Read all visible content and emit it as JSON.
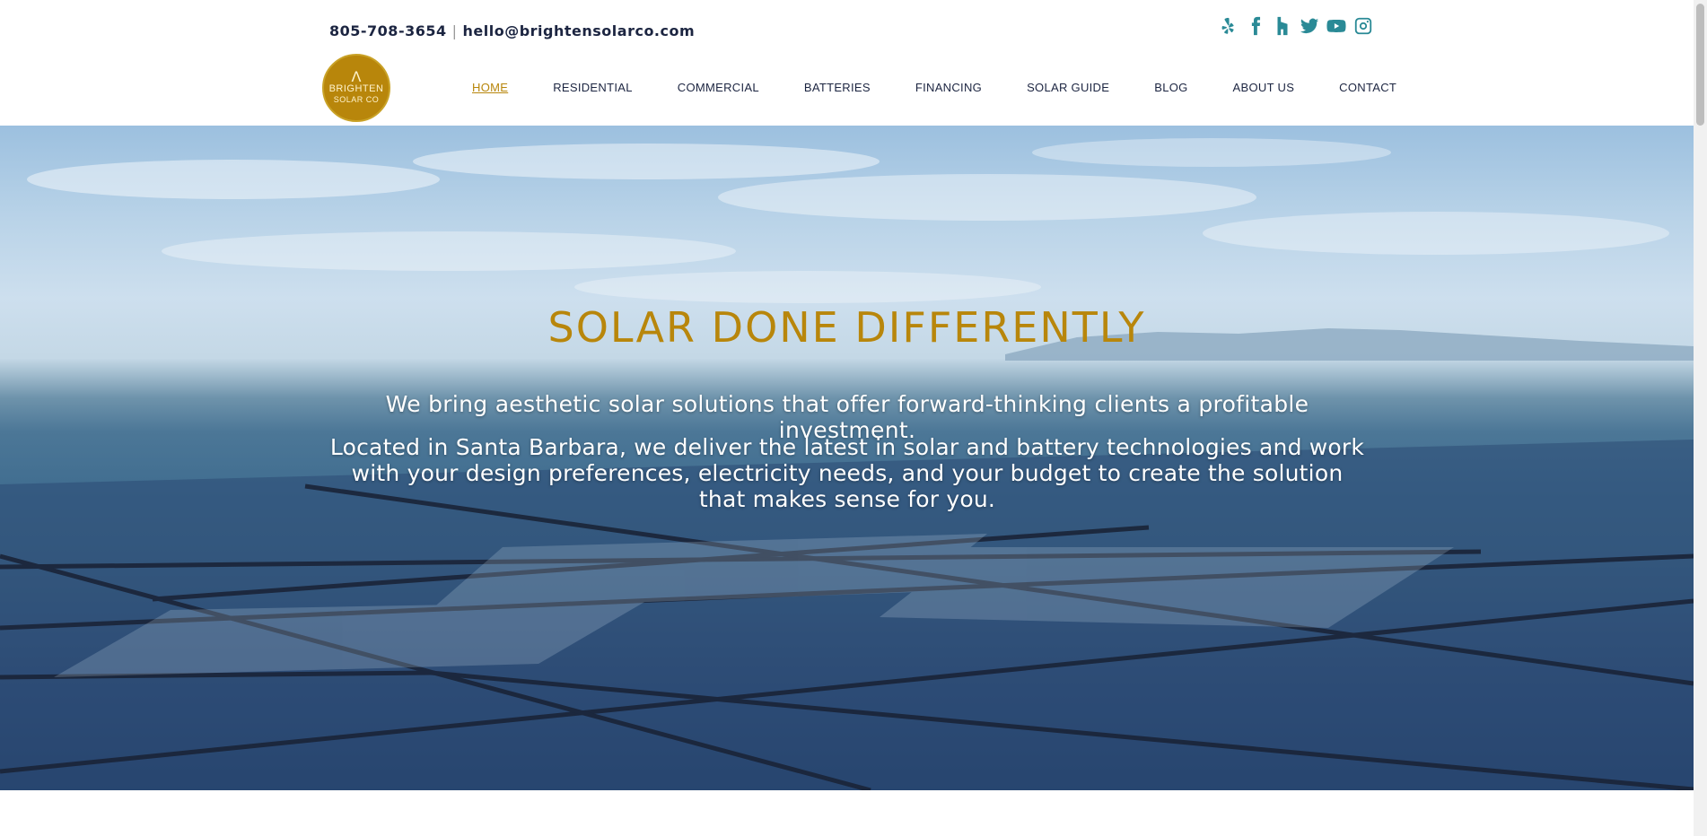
{
  "header": {
    "phone": "805-708-3654",
    "separator": "|",
    "email": "hello@brightensolarco.com",
    "social_icons": [
      "yelp-icon",
      "facebook-icon",
      "houzz-icon",
      "twitter-icon",
      "youtube-icon",
      "instagram-icon"
    ],
    "logo": {
      "line1": "BRIGHTEN",
      "line2": "SOLAR CO"
    }
  },
  "nav": {
    "items": [
      {
        "label": "HOME",
        "active": true
      },
      {
        "label": "RESIDENTIAL"
      },
      {
        "label": "COMMERCIAL"
      },
      {
        "label": "BATTERIES"
      },
      {
        "label": "FINANCING"
      },
      {
        "label": "SOLAR GUIDE"
      },
      {
        "label": "BLOG"
      },
      {
        "label": "ABOUT US"
      },
      {
        "label": "CONTACT"
      }
    ]
  },
  "hero": {
    "title": "SOLAR DONE DIFFERENTLY",
    "subtitle": "We bring aesthetic solar solutions that offer forward-thinking clients a profitable investment.",
    "body": "Located in Santa Barbara, we deliver the latest in solar and battery technologies and work with your design preferences, electricity needs, and your budget to create the solution that makes sense for you."
  },
  "colors": {
    "accent_gold": "#b8860b",
    "navy_text": "#1c2541",
    "social_teal": "#2a8a96"
  }
}
